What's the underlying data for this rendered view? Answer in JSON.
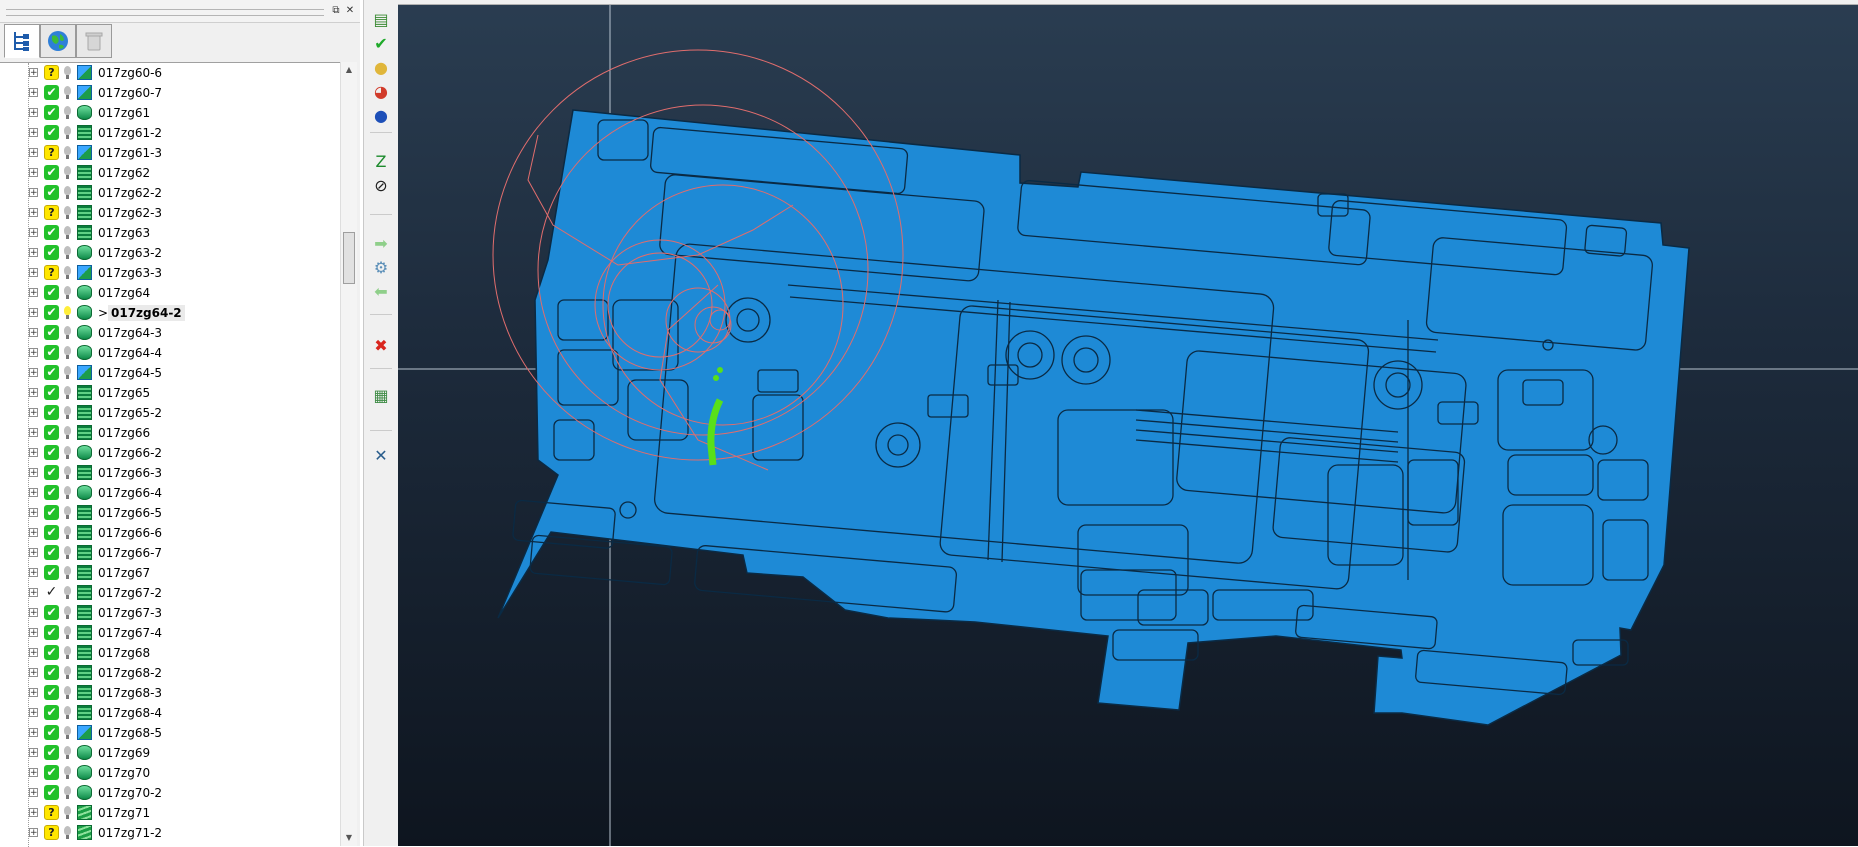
{
  "panel": {
    "restore_glyph": "⧉",
    "close_glyph": "✕",
    "tabs": [
      {
        "name": "tree-tab",
        "icon": "tree-icon",
        "active": true
      },
      {
        "name": "globe-tab",
        "icon": "globe-icon",
        "active": false
      },
      {
        "name": "trash-tab",
        "icon": "trash-icon",
        "active": false
      }
    ]
  },
  "tree": {
    "items": [
      {
        "label": "017zg60-6",
        "status": "warn",
        "light": "off",
        "part_icon": "blue"
      },
      {
        "label": "017zg60-7",
        "status": "ok",
        "light": "off",
        "part_icon": "blue"
      },
      {
        "label": "017zg61",
        "status": "ok",
        "light": "off",
        "part_icon": "disk"
      },
      {
        "label": "017zg61-2",
        "status": "ok",
        "light": "off",
        "part_icon": "lines"
      },
      {
        "label": "017zg61-3",
        "status": "warn",
        "light": "off",
        "part_icon": "blue"
      },
      {
        "label": "017zg62",
        "status": "ok",
        "light": "off",
        "part_icon": "lines"
      },
      {
        "label": "017zg62-2",
        "status": "ok",
        "light": "off",
        "part_icon": "lines"
      },
      {
        "label": "017zg62-3",
        "status": "warn",
        "light": "off",
        "part_icon": "lines"
      },
      {
        "label": "017zg63",
        "status": "ok",
        "light": "off",
        "part_icon": "lines"
      },
      {
        "label": "017zg63-2",
        "status": "ok",
        "light": "off",
        "part_icon": "disk"
      },
      {
        "label": "017zg63-3",
        "status": "warn",
        "light": "off",
        "part_icon": "blue"
      },
      {
        "label": "017zg64",
        "status": "ok",
        "light": "off",
        "part_icon": "disk"
      },
      {
        "label": "017zg64-2",
        "status": "ok",
        "light": "on",
        "part_icon": "disk",
        "selected": true
      },
      {
        "label": "017zg64-3",
        "status": "ok",
        "light": "off",
        "part_icon": "disk"
      },
      {
        "label": "017zg64-4",
        "status": "ok",
        "light": "off",
        "part_icon": "disk"
      },
      {
        "label": "017zg64-5",
        "status": "ok",
        "light": "off",
        "part_icon": "blue"
      },
      {
        "label": "017zg65",
        "status": "ok",
        "light": "off",
        "part_icon": "lines"
      },
      {
        "label": "017zg65-2",
        "status": "ok",
        "light": "off",
        "part_icon": "lines"
      },
      {
        "label": "017zg66",
        "status": "ok",
        "light": "off",
        "part_icon": "lines"
      },
      {
        "label": "017zg66-2",
        "status": "ok",
        "light": "off",
        "part_icon": "disk"
      },
      {
        "label": "017zg66-3",
        "status": "ok",
        "light": "off",
        "part_icon": "lines"
      },
      {
        "label": "017zg66-4",
        "status": "ok",
        "light": "off",
        "part_icon": "disk"
      },
      {
        "label": "017zg66-5",
        "status": "ok",
        "light": "off",
        "part_icon": "lines"
      },
      {
        "label": "017zg66-6",
        "status": "ok",
        "light": "off",
        "part_icon": "lines"
      },
      {
        "label": "017zg66-7",
        "status": "ok",
        "light": "off",
        "part_icon": "lines"
      },
      {
        "label": "017zg67",
        "status": "ok",
        "light": "off",
        "part_icon": "lines"
      },
      {
        "label": "017zg67-2",
        "status": "plain",
        "light": "off",
        "part_icon": "lines"
      },
      {
        "label": "017zg67-3",
        "status": "ok",
        "light": "off",
        "part_icon": "lines"
      },
      {
        "label": "017zg67-4",
        "status": "ok",
        "light": "off",
        "part_icon": "lines"
      },
      {
        "label": "017zg68",
        "status": "ok",
        "light": "off",
        "part_icon": "lines"
      },
      {
        "label": "017zg68-2",
        "status": "ok",
        "light": "off",
        "part_icon": "lines"
      },
      {
        "label": "017zg68-3",
        "status": "ok",
        "light": "off",
        "part_icon": "lines"
      },
      {
        "label": "017zg68-4",
        "status": "ok",
        "light": "off",
        "part_icon": "lines"
      },
      {
        "label": "017zg68-5",
        "status": "ok",
        "light": "off",
        "part_icon": "blue"
      },
      {
        "label": "017zg69",
        "status": "ok",
        "light": "off",
        "part_icon": "disk"
      },
      {
        "label": "017zg70",
        "status": "ok",
        "light": "off",
        "part_icon": "disk"
      },
      {
        "label": "017zg70-2",
        "status": "ok",
        "light": "off",
        "part_icon": "disk"
      },
      {
        "label": "017zg71",
        "status": "warn",
        "light": "off",
        "part_icon": "stack"
      },
      {
        "label": "017zg71-2",
        "status": "warn",
        "light": "off",
        "part_icon": "stack"
      }
    ],
    "selection_marker": ">",
    "expand_glyph": "+",
    "status_glyphs": {
      "ok": "✔",
      "warn": "?",
      "plain": "✓"
    }
  },
  "toolbar": {
    "tools": [
      {
        "name": "open-part-button",
        "icon": "stack-icon",
        "glyph": "▤",
        "color": "#3b8b34"
      },
      {
        "name": "check-button",
        "icon": "checkmark-icon",
        "glyph": "✔",
        "color": "#1faa2a"
      },
      {
        "name": "yellow-sphere-button",
        "icon": "sphere-icon",
        "glyph": "●",
        "color": "#e0b63a"
      },
      {
        "name": "color-sphere-button",
        "icon": "color-sphere-icon",
        "glyph": "◕",
        "color": "#d13b2a"
      },
      {
        "name": "blue-sphere-button",
        "icon": "blue-sphere-icon",
        "glyph": "●",
        "color": "#1d4fb8"
      },
      {
        "name": "zoom-fit-button",
        "icon": "zoom-fit-icon",
        "glyph": "Z",
        "color": "#1c8a2c"
      },
      {
        "name": "measure-button",
        "icon": "wrench-icon",
        "glyph": "⊘",
        "color": "#202020"
      },
      {
        "name": "forward-button",
        "icon": "arrow-right-icon",
        "glyph": "➡",
        "color": "#8fcf8a"
      },
      {
        "name": "settings-button",
        "icon": "gear-icon",
        "glyph": "⚙",
        "color": "#5b8fb8"
      },
      {
        "name": "back-button",
        "icon": "arrow-left-icon",
        "glyph": "⬅",
        "color": "#8fcf8a"
      },
      {
        "name": "delete-button",
        "icon": "red-x-icon",
        "glyph": "✖",
        "color": "#d9251d"
      },
      {
        "name": "layer-button",
        "icon": "grid-icon",
        "glyph": "▦",
        "color": "#3f8c46"
      },
      {
        "name": "close-toolbar-button",
        "icon": "close-icon",
        "glyph": "✕",
        "color": "#2a5d8c"
      }
    ]
  },
  "viewport": {
    "model_color": "#1e8ad6",
    "edge_color": "#0a2a44",
    "guide_color": "#b8c4d0",
    "circle_color": "#e06d6d",
    "highlight_color": "#58e019"
  }
}
